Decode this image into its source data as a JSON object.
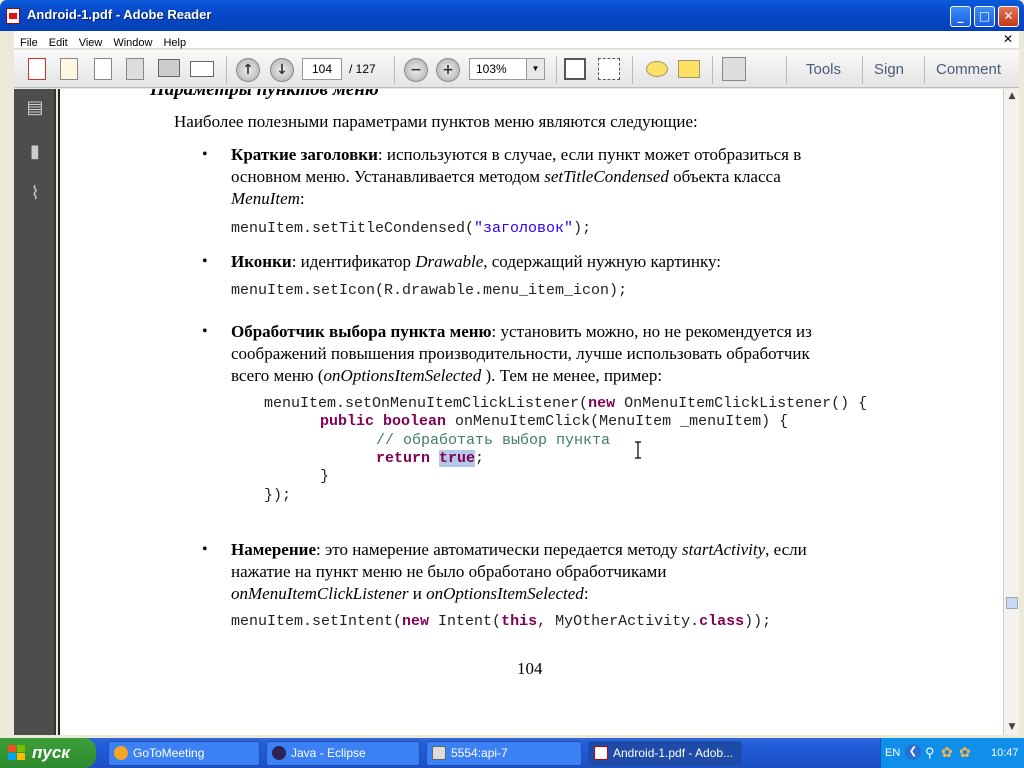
{
  "window": {
    "title": "Android-1.pdf - Adobe Reader"
  },
  "menu": [
    "File",
    "Edit",
    "View",
    "Window",
    "Help"
  ],
  "toolbar": {
    "page_current": "104",
    "page_total": "/ 127",
    "zoom": "103%",
    "tools_label": "Tools",
    "sign_label": "Sign",
    "comment_label": "Comment"
  },
  "document": {
    "heading": "Параметры пунктов меню",
    "intro": "Наиболее полезными параметрами пунктов меню являются следующие:",
    "bullet1": {
      "bold": "Краткие заголовки",
      "line1": ": используются в случае, если пункт может отобразиться в",
      "line2a": "основном меню. Устанавливается методом ",
      "line2_italic": "setTitleCondensed",
      "line2b": " объекта класса",
      "line3_italic": "MenuItem",
      "line3b": ":",
      "code_pre": "menuItem.setTitleCondensed(",
      "code_str": "\"заголовок\"",
      "code_post": ");"
    },
    "bullet2": {
      "bold": "Иконки",
      "text_a": ": идентификатор ",
      "italic": "Drawable",
      "text_b": ", содержащий нужную картинку:",
      "code": "menuItem.setIcon(R.drawable.menu_item_icon);"
    },
    "bullet3": {
      "bold": "Обработчик выбора пункта меню",
      "line1": ": установить можно, но не рекомендуется из",
      "line2": "соображений повышения производительности, лучше использовать обработчик",
      "line3a": "всего меню (",
      "line3_italic": "onOptionsItemSelected",
      "line3b": " ). Тем не менее, пример:",
      "code1a": "menuItem.setOnMenuItemClickListener(",
      "code1kw": "new",
      "code1b": " OnMenuItemClickListener() {",
      "code2kw1": "public",
      "code2kw2": "boolean",
      "code2b": " onMenuItemClick(MenuItem _menuItem) {",
      "code3": "// обработать выбор пункта",
      "code4kw": "return",
      "code4sel": "true",
      "code4b": ";",
      "code5": "}",
      "code6": "});"
    },
    "bullet4": {
      "bold": "Намерение",
      "line1a": ": это намерение автоматически передается методу ",
      "line1_italic": "startActivity",
      "line1b": ", если",
      "line2": "нажатие на пункт меню не было обработано обработчиками",
      "line3_italic1": "onMenuItemClickListener",
      "line3_mid": " и ",
      "line3_italic2": "onOptionsItemSelected",
      "line3b": ":",
      "code_a": "menuItem.setIntent(",
      "code_kw1": "new",
      "code_b": " Intent(",
      "code_kw2": "this",
      "code_c": ", MyOtherActivity.",
      "code_kw3": "class",
      "code_d": "));"
    },
    "page_number": "104"
  },
  "taskbar": {
    "start_label": "пуск",
    "tasks": [
      "GoToMeeting",
      "Java - Eclipse",
      "5554:api-7",
      "Android-1.pdf - Adob..."
    ],
    "lang": "EN",
    "clock": "10:47"
  }
}
